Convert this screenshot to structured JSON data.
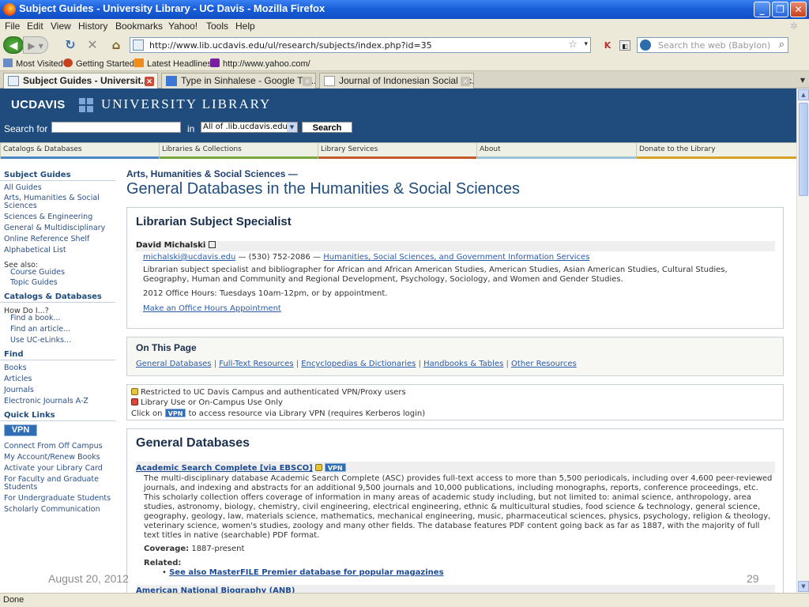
{
  "window": {
    "title": "Subject Guides - University Library - UC Davis - Mozilla Firefox",
    "controls": {
      "minimize": "_",
      "maximize": "❐",
      "close": "✕"
    }
  },
  "menu": [
    "File",
    "Edit",
    "View",
    "History",
    "Bookmarks",
    "Yahoo!",
    "Tools",
    "Help"
  ],
  "toolbar": {
    "url": "http://www.lib.ucdavis.edu/ul/research/subjects/index.php?id=35",
    "search_placeholder": "Search the web (Babylon)"
  },
  "bookmarks": [
    "Most Visited",
    "Getting Started",
    "Latest Headlines",
    "http://www.yahoo.com/"
  ],
  "tabs": [
    {
      "label": "Subject Guides - Universit..."
    },
    {
      "label": "Type in Sinhalese - Google Tra..."
    },
    {
      "label": "Journal of Indonesian Social Sc..."
    }
  ],
  "site": {
    "logo_ucd": "UCDAVIS",
    "logo_lib": "UNIVERSITY LIBRARY",
    "search_label": "Search for",
    "in_label": "in",
    "scope": "All of .lib.ucdavis.edu",
    "search_button": "Search",
    "nav": [
      {
        "label": "Catalogs & Databases",
        "color": "#4a86c7"
      },
      {
        "label": "Libraries & Collections",
        "color": "#7aa83d"
      },
      {
        "label": "Library Services",
        "color": "#c45a2c"
      },
      {
        "label": "About",
        "color": "#9bc3d6"
      },
      {
        "label": "Donate to the Library",
        "color": "#d8a12a"
      }
    ]
  },
  "sidebar": {
    "subject_guides": "Subject Guides",
    "guides": [
      "All Guides",
      "Arts, Humanities & Social Sciences",
      "Sciences & Engineering",
      "General & Multidisciplinary",
      "Online Reference Shelf",
      "Alphabetical List"
    ],
    "see_also": "See also:",
    "see_also_links": [
      "Course Guides",
      "Topic Guides"
    ],
    "catalogs": "Catalogs & Databases",
    "how_do_i": "How Do I...?",
    "how_links": [
      "Find a book...",
      "Find an article...",
      "Use UC-eLinks..."
    ],
    "find": "Find",
    "find_links": [
      "Books",
      "Articles",
      "Journals",
      "Electronic Journals A-Z"
    ],
    "quick_links": "Quick Links",
    "vpn": "VPN",
    "quick": [
      "Connect From Off Campus",
      "My Account/Renew Books",
      "Activate your Library Card",
      "For Faculty and Graduate Students",
      "For Undergraduate Students",
      "Scholarly Communication"
    ]
  },
  "main": {
    "crumb": "Arts, Humanities & Social Sciences —",
    "title": "General Databases in the Humanities & Social Sciences",
    "specialist": {
      "heading": "Librarian Subject Specialist",
      "name": "David Michalski",
      "email": "michalski@ucdavis.edu",
      "phone": "— (530) 752-2086 —",
      "dept": "Humanities, Social Sciences, and Government Information Services",
      "bio": "Librarian subject specialist and bibliographer for African and African American Studies, American Studies, Asian American Studies, Cultural Studies, Geography, Human and Community and Regional Development, Psychology, Sociology, and Women and Gender Studies.",
      "hours": "2012 Office Hours: Tuesdays 10am-12pm, or by appointment.",
      "appointment": "Make an Office Hours Appointment"
    },
    "on_this_page": {
      "heading": "On This Page",
      "links": [
        "General Databases",
        "Full-Text Resources",
        "Encyclopedias & Dictionaries",
        "Handbooks & Tables",
        "Other Resources"
      ],
      "separator": "|"
    },
    "legend": {
      "restricted": "Restricted to UC Davis Campus and authenticated VPN/Proxy users",
      "onsite": "Library Use or On-Campus Use Only",
      "click_on": "Click on",
      "vpn": "VPN",
      "vpn_note": "to access resource via Library VPN (requires Kerberos login)"
    },
    "general": {
      "heading": "General Databases",
      "db_title": "Academic Search Complete [via EBSCO]",
      "db_vpn": "VPN",
      "db_desc": "The multi-disciplinary database Academic Search Complete (ASC) provides full-text access to more than 5,500 periodicals, including over 4,600 peer-reviewed journals, and indexing and abstracts for an additional 9,500 journals and 10,000 publications, including monographs, reports, conference proceedings, etc. This scholarly collection offers coverage of information in many areas of academic study including, but not limited to: animal science, anthropology, area studies, astronomy, biology, chemistry, civil engineering, electrical engineering, ethnic & multicultural studies, food science & technology, general science, geography, geology, law, materials science, mathematics, mechanical engineering, music, pharmaceutical sciences, physics, psychology, religion & theology, veterinary science, women's studies, zoology and many other fields. The database features PDF content going back as far as 1887, with the majority of full text titles in native (searchable) PDF format.",
      "coverage_label": "Coverage:",
      "coverage": "1887-present",
      "related_label": "Related:",
      "related_link": "See also MasterFILE Premier database for popular magazines",
      "next_title": "American National Biography (ANB)"
    }
  },
  "slide": {
    "date": "August 20, 2012",
    "number": "29"
  },
  "status": "Done"
}
